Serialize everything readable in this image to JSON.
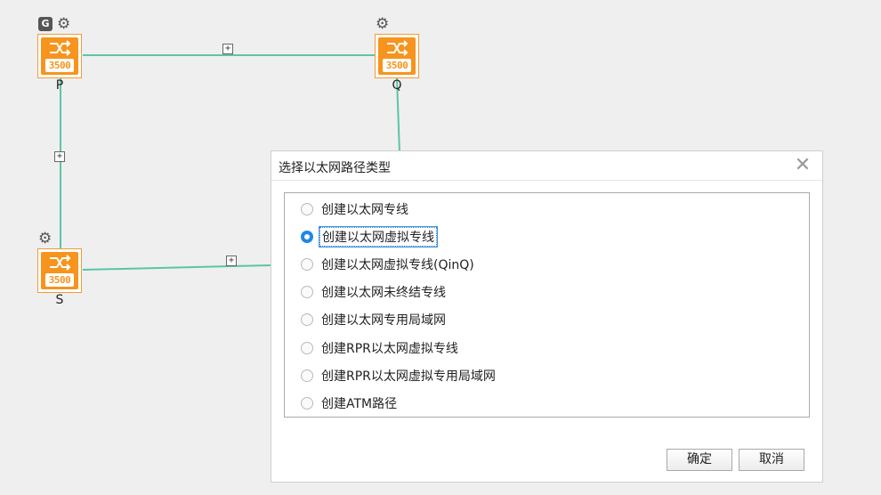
{
  "topology": {
    "nodes": [
      {
        "id": "P",
        "label": "P",
        "model": "3500",
        "badge": "G"
      },
      {
        "id": "Q",
        "label": "Q",
        "model": "3500"
      },
      {
        "id": "S",
        "label": "S",
        "model": "3500"
      }
    ],
    "link_expand_symbol": "+",
    "colors": {
      "link": "#5cc4a8",
      "device": "#f7941d"
    }
  },
  "dialog": {
    "title": "选择以太网路径类型",
    "close_symbol": "✕",
    "options": [
      {
        "label": "创建以太网专线",
        "selected": false
      },
      {
        "label": "创建以太网虚拟专线",
        "selected": true
      },
      {
        "label": "创建以太网虚拟专线(QinQ)",
        "selected": false
      },
      {
        "label": "创建以太网未终结专线",
        "selected": false
      },
      {
        "label": "创建以太网专用局域网",
        "selected": false
      },
      {
        "label": "创建RPR以太网虚拟专线",
        "selected": false
      },
      {
        "label": "创建RPR以太网虚拟专用局域网",
        "selected": false
      },
      {
        "label": "创建ATM路径",
        "selected": false
      }
    ],
    "ok_label": "确定",
    "cancel_label": "取消"
  }
}
